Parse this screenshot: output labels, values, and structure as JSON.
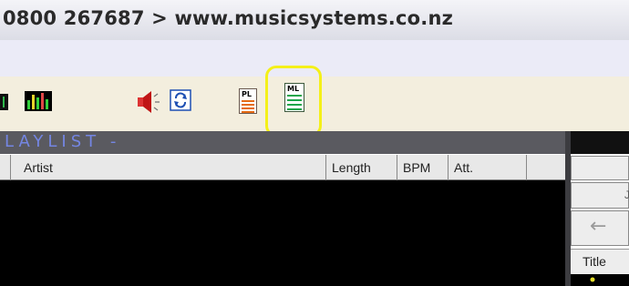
{
  "titlebar": {
    "text": "0800 267687 > www.musicsystems.co.nz"
  },
  "toolbar": {
    "icons": [
      "stop-icon",
      "level-meter-icon",
      "speaker-icon",
      "refresh-icon",
      "playlist-icon",
      "media-library-icon"
    ],
    "pl_code": "PL",
    "ml_code": "ML",
    "highlight_color": "#f4f018"
  },
  "playlist": {
    "header": "LAYLIST -",
    "columns": [
      "Artist",
      "Length",
      "BPM",
      "Att."
    ]
  },
  "right_pane": {
    "column_title": "Title",
    "button_char": "J",
    "back_arrow": "←"
  }
}
